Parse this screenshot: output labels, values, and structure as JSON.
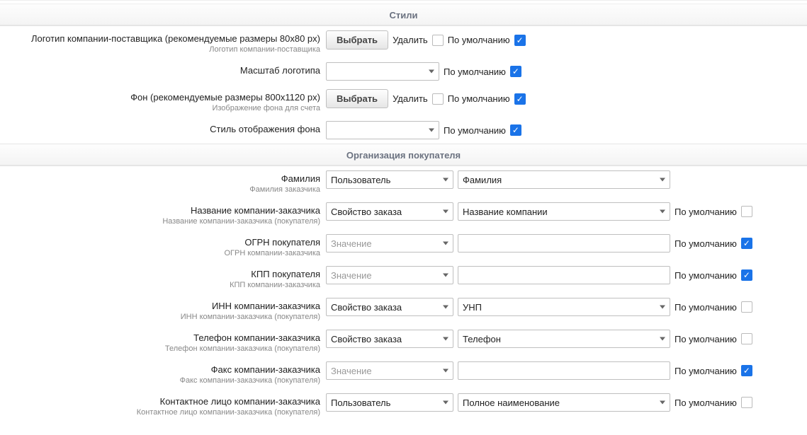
{
  "common": {
    "default_label": "По умолчанию",
    "delete_label": "Удалить",
    "choose_label": "Выбрать"
  },
  "sections": {
    "styles": {
      "title": "Стили"
    },
    "buyer_org": {
      "title": "Организация покупателя"
    }
  },
  "styles": {
    "logo": {
      "label": "Логотип компании-поставщика (рекомендуемые размеры 80x80 px)",
      "sub": "Логотип компании-поставщика",
      "default_checked": true
    },
    "logo_scale": {
      "label": "Масштаб логотипа",
      "value": "",
      "default_checked": true
    },
    "bg": {
      "label": "Фон (рекомендуемые размеры 800x1120 px)",
      "sub": "Изображение фона для счета",
      "default_checked": true
    },
    "bg_style": {
      "label": "Стиль отображения фона",
      "value": "",
      "default_checked": true
    }
  },
  "buyer": {
    "lastname": {
      "label": "Фамилия",
      "sub": "Фамилия заказчика",
      "source": "Пользователь",
      "value": "Фамилия"
    },
    "company": {
      "label": "Название компании-заказчика",
      "sub": "Название компании-заказчика (покупателя)",
      "source": "Свойство заказа",
      "value": "Название компании",
      "default_checked": false
    },
    "ogrn": {
      "label": "ОГРН покупателя",
      "sub": "ОГРН компании-заказчика",
      "source_placeholder": "Значение",
      "value": "",
      "default_checked": true
    },
    "kpp": {
      "label": "КПП покупателя",
      "sub": "КПП компании-заказчика",
      "source_placeholder": "Значение",
      "value": "",
      "default_checked": true
    },
    "inn": {
      "label": "ИНН компании-заказчика",
      "sub": "ИНН компании-заказчика (покупателя)",
      "source": "Свойство заказа",
      "value": "УНП",
      "default_checked": false
    },
    "phone": {
      "label": "Телефон компании-заказчика",
      "sub": "Телефон компании-заказчика (покупателя)",
      "source": "Свойство заказа",
      "value": "Телефон",
      "default_checked": false
    },
    "fax": {
      "label": "Факс компании-заказчика",
      "sub": "Факс компании-заказчика (покупателя)",
      "source_placeholder": "Значение",
      "value": "",
      "default_checked": true
    },
    "contact": {
      "label": "Контактное лицо компании-заказчика",
      "sub": "Контактное лицо компании-заказчика (покупателя)",
      "source": "Пользователь",
      "value": "Полное наименование",
      "default_checked": false
    }
  }
}
